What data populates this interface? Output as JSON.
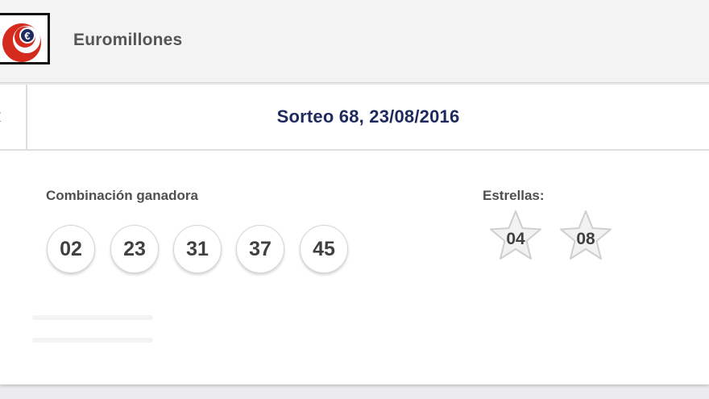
{
  "header": {
    "app_title": "Euromillones",
    "logo_symbol": "€",
    "logo_colors": {
      "ring": "#d42b1e",
      "inner": "#1e2a5e"
    }
  },
  "nav": {
    "prev_glyph": "‹",
    "draw_title": "Sorteo 68, 23/08/2016"
  },
  "results": {
    "combination_label": "Combinación ganadora",
    "numbers": [
      "02",
      "23",
      "31",
      "37",
      "45"
    ],
    "stars_label": "Estrellas:",
    "stars": [
      "04",
      "08"
    ]
  },
  "colors": {
    "accent_navy": "#1e2a5e",
    "background": "#ececee",
    "card": "#ffffff"
  }
}
